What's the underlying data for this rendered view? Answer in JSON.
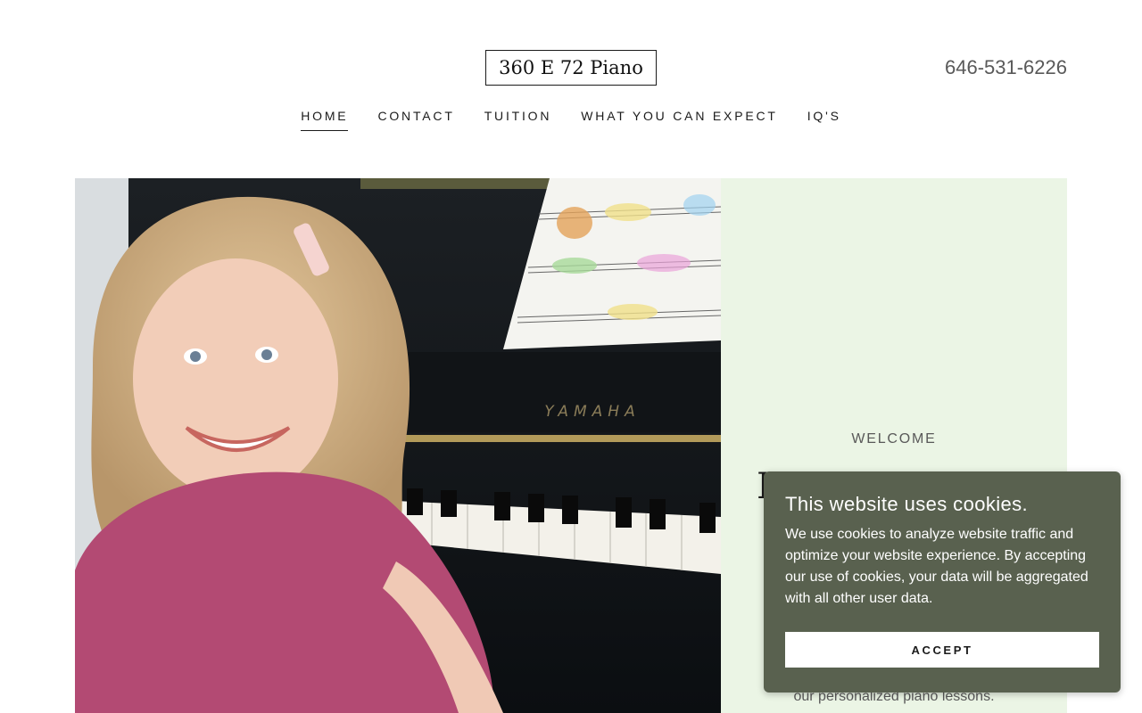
{
  "header": {
    "logo_text": "360 E 72 Piano",
    "phone": "646-531-6226"
  },
  "nav": {
    "items": [
      {
        "label": "HOME",
        "active": true
      },
      {
        "label": "CONTACT",
        "active": false
      },
      {
        "label": "TUITION",
        "active": false
      },
      {
        "label": "WHAT YOU CAN EXPECT",
        "active": false
      },
      {
        "label": "IQ'S",
        "active": false
      }
    ]
  },
  "hero": {
    "image_piano_brand": "YAMAHA",
    "welcome": "WELCOME",
    "title_partial": "I",
    "subtitle_partial": "our personalized piano lessons.",
    "panel_color": "#ebf5e5"
  },
  "cookie": {
    "title": "This website uses cookies.",
    "body": "We use cookies to analyze website traffic and optimize your website experience. By accepting our use of cookies, your data will be aggregated with all other user data.",
    "accept_label": "ACCEPT",
    "bg_color": "#59614f"
  }
}
